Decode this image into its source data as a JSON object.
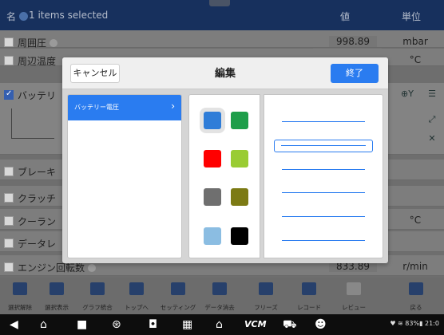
{
  "header": {
    "col_name": "名",
    "selection": "1 items selected",
    "col_value": "値",
    "col_unit": "単位"
  },
  "rows": [
    {
      "name": "周囲圧",
      "value": "998.89",
      "unit": "mbar",
      "checked": false
    },
    {
      "name": "周辺温度",
      "value": "",
      "unit": "°C",
      "checked": false
    },
    {
      "name": "バッテリ",
      "value": "",
      "unit": "",
      "checked": true
    },
    {
      "name": "ブレーキ",
      "value": "",
      "unit": "",
      "checked": false
    },
    {
      "name": "クラッチ",
      "value": "",
      "unit": "",
      "checked": false
    },
    {
      "name": "クーラン",
      "value": "",
      "unit": "°C",
      "checked": false
    },
    {
      "name": "データレ",
      "value": "",
      "unit": "",
      "checked": false
    },
    {
      "name": "エンジン回転数",
      "value": "833.89",
      "unit": "r/min",
      "checked": false
    }
  ],
  "side_buttons": {
    "zoom": "⊕Y",
    "menu": "☰",
    "expand": "⤢",
    "close": "✕"
  },
  "modal": {
    "cancel_label": "キャンセル",
    "title": "編集",
    "done_label": "終了",
    "list_items": [
      {
        "label": "バッテリー電圧",
        "selected": true
      }
    ],
    "colors": [
      "#2f7dd8",
      "#1e9e4a",
      "#ff0000",
      "#99cc33",
      "#6f6f6f",
      "#7c7a14",
      "#8bbde2",
      "#000000"
    ],
    "selected_color_index": 0,
    "line_styles_count": 6,
    "selected_line_index": 1
  },
  "toolbar": [
    {
      "icon": "clear-selection-icon",
      "label": "選択解除"
    },
    {
      "icon": "show-selected-icon",
      "label": "選択表示"
    },
    {
      "icon": "graph-merge-icon",
      "label": "グラフ統合"
    },
    {
      "icon": "top-icon",
      "label": "トップへ"
    },
    {
      "icon": "settings-icon",
      "label": "セッティング"
    },
    {
      "icon": "trash-icon",
      "label": "データ消去"
    },
    {
      "icon": "freeze-icon",
      "label": "フリーズ"
    },
    {
      "icon": "record-icon",
      "label": "レコード"
    },
    {
      "icon": "review-icon",
      "label": "レビュー"
    },
    {
      "icon": "back-icon",
      "label": "戻る"
    }
  ],
  "status_bar": {
    "text": "♥ ≋ 83%▮ 21:0"
  }
}
